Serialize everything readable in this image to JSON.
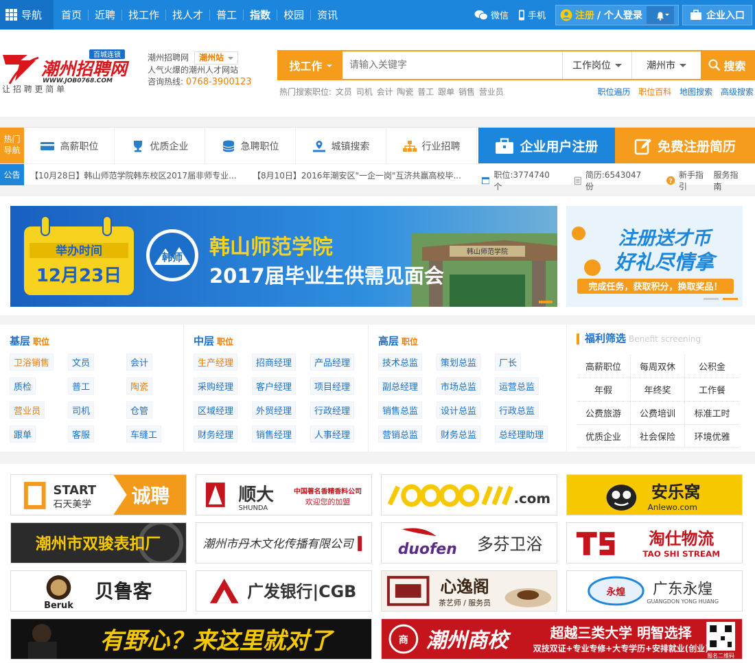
{
  "topbar": {
    "nav_label": "导航",
    "links": [
      "首页",
      "近聘",
      "找工作",
      "找人才",
      "普工",
      "指数",
      "校园",
      "资讯"
    ],
    "wechat": "微信",
    "mobile": "手机",
    "register": "注册",
    "login": "/ 个人登录",
    "enterprise": "企业入口"
  },
  "header": {
    "logo_brand": "潮州招聘网",
    "logo_badge": "百城连锁",
    "logo_domain": "WWW.JOB0768.COM",
    "logo_slogan": "让 招 聘 更 简 单",
    "site_name": "潮州招聘网",
    "station": "潮州站",
    "tagline": "人气火爆的潮州人才网站",
    "hotline_label": "咨询热线:",
    "hotline": "0768-3900123"
  },
  "search": {
    "type": "找工作",
    "placeholder": "请输入关键字",
    "category": "工作岗位",
    "city": "潮州市",
    "button": "搜索",
    "hot_label": "热门搜索职位:",
    "hot_words": [
      "文员",
      "司机",
      "会计",
      "陶瓷",
      "普工",
      "跟单",
      "销售",
      "营业员"
    ],
    "links": [
      "职位遍历",
      "职位百科",
      "地图搜索",
      "高级搜索"
    ]
  },
  "categories": {
    "tag": "热门导航",
    "items": [
      "高薪职位",
      "优质企业",
      "急聘职位",
      "城镇搜索",
      "行业招聘"
    ],
    "cta_enterprise": "企业用户注册",
    "cta_resume": "免费注册简历"
  },
  "notice": {
    "tag": "公告",
    "items": [
      "【10月28日】韩山师范学院韩东校区2017届非师专业...",
      "【8月10日】2016年潮安区\"一企一岗\"互济共赢高校毕..."
    ],
    "jobs": "职位:3774740个",
    "resumes": "简历:6543047份",
    "guide": "新手指引",
    "service": "服务指南"
  },
  "banner": {
    "date_title": "举办时间",
    "date": "12月23日",
    "logo_text": "韩师",
    "school": "韩山师范学院",
    "event": "2017届毕业生供需见面会",
    "gate": "韩山师范学院",
    "side_line1": "注册送才币",
    "side_line2": "好礼尽情拿",
    "side_line3": "完成任务，获取积分，换取奖品！"
  },
  "positions": {
    "suffix": "职位",
    "basic": {
      "title": "基层",
      "tags": [
        "卫浴销售",
        "文员",
        "会计",
        "质检",
        "普工",
        "陶瓷",
        "营业员",
        "司机",
        "仓管",
        "跟单",
        "客服",
        "车缝工"
      ]
    },
    "middle": {
      "title": "中层",
      "tags": [
        "生产经理",
        "招商经理",
        "产品经理",
        "采购经理",
        "客户经理",
        "项目经理",
        "区域经理",
        "外贸经理",
        "行政经理",
        "财务经理",
        "销售经理",
        "人事经理"
      ]
    },
    "senior": {
      "title": "高层",
      "tags": [
        "技术总监",
        "策划总监",
        "厂长",
        "副总经理",
        "市场总监",
        "运营总监",
        "销售总监",
        "设计总监",
        "行政总监",
        "营销总监",
        "财务总监",
        "总经理助理"
      ]
    },
    "welfare": {
      "title": "福利筛选",
      "subtitle": "Benefit screening",
      "items": [
        "高薪职位",
        "每周双休",
        "公积金",
        "年假",
        "年终奖",
        "工作餐",
        "公费旅游",
        "公费培训",
        "标准工时",
        "优质企业",
        "社会保险",
        "环境优雅"
      ]
    }
  },
  "ads": {
    "a1_brand": "START",
    "a1_sub": "石天美学",
    "a1_tag": "诚聘",
    "a2_brand": "顺大",
    "a2_en": "SHUNDA",
    "a2_line1": "中国著名香精香料公司",
    "a2_line2": "欢迎您的加盟",
    "a3_brand": ".com",
    "a4_brand": "安乐窝",
    "a4_en": "Anlewo.com",
    "b1_text": "潮州市双骏表扣厂",
    "b2_text": "潮州市丹木文化传播有限公司",
    "b3_brand": "duofen",
    "b3_text": "多芬卫浴",
    "b4_text": "淘仕物流",
    "b4_en": "TAO SHI STREAM",
    "c1_text": "贝鲁客",
    "c1_en": "Beruk",
    "c2_text": "广发银行|CGB",
    "c3_text": "心逸阁",
    "c3_sub": "茶艺师 / 服务员",
    "c4_text": "广东永煌",
    "c4_en": "GUANGDON YONG HUANG",
    "d1_text": "有野心？来这里就对了",
    "d2_brand": "潮州商校",
    "d2_line1": "超越三类大学  明智选择",
    "d2_line2": "双技双证+专业专修+大专学历+安排就业(创业)",
    "d2_qr": "报名二维码"
  }
}
